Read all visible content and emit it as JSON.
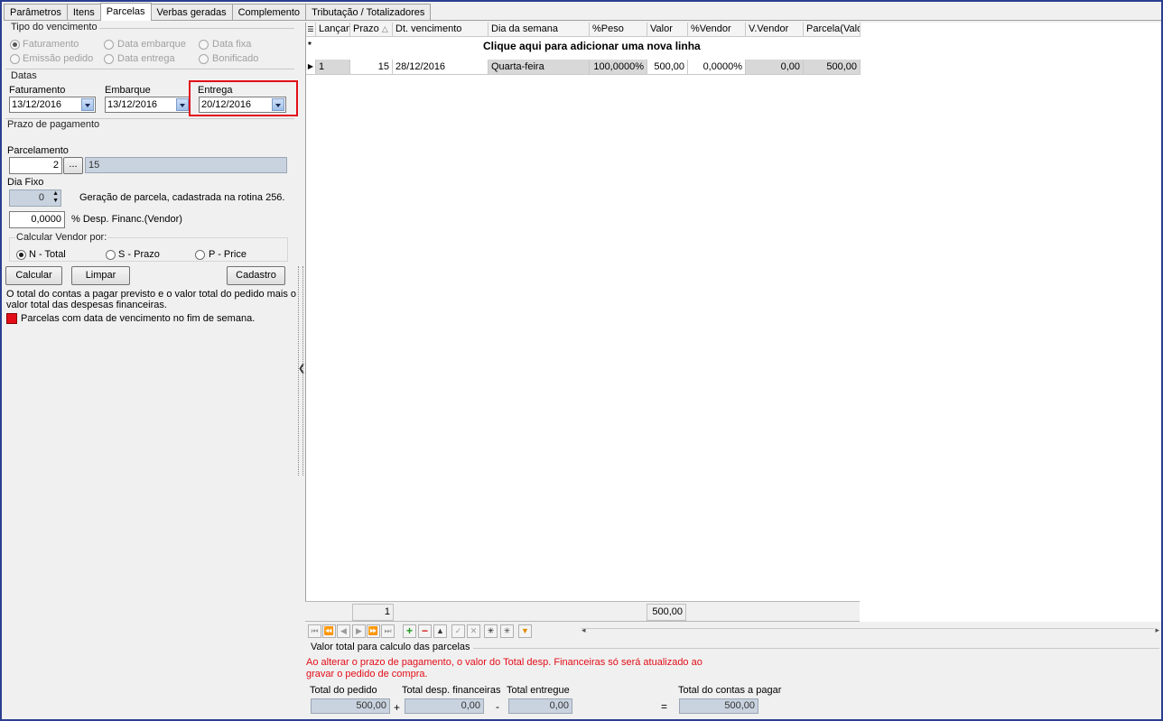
{
  "tabs": [
    {
      "label": "Parâmetros"
    },
    {
      "label": "Itens"
    },
    {
      "label": "Parcelas"
    },
    {
      "label": "Verbas geradas"
    },
    {
      "label": "Complemento"
    },
    {
      "label": "Tributação / Totalizadores"
    }
  ],
  "active_tab": "Parcelas",
  "tipo_vencimento": {
    "title": "Tipo do vencimento",
    "options": [
      {
        "label": "Faturamento",
        "checked": true
      },
      {
        "label": "Data embarque",
        "checked": false
      },
      {
        "label": "Data fixa",
        "checked": false
      },
      {
        "label": "Emissão pedido",
        "checked": false
      },
      {
        "label": "Data entrega",
        "checked": false
      },
      {
        "label": "Bonificado",
        "checked": false
      }
    ]
  },
  "datas": {
    "title": "Datas",
    "faturamento": {
      "label": "Faturamento",
      "value": "13/12/2016"
    },
    "embarque": {
      "label": "Embarque",
      "value": "13/12/2016"
    },
    "entrega": {
      "label": "Entrega",
      "value": "20/12/2016"
    }
  },
  "prazo": {
    "title": "Prazo de pagamento",
    "parcelamento_label": "Parcelamento",
    "parcelamento_value": "2",
    "ellipsis_label": "...",
    "parcelas_text": "15",
    "dia_fixo_label": "Dia Fixo",
    "dia_fixo_value": "0",
    "geracao_text": "Geração de parcela, cadastrada na rotina 256.",
    "desp_value": "0,0000",
    "desp_label": "% Desp. Financ.(Vendor)"
  },
  "calcular_vendor": {
    "title": "Calcular Vendor por:",
    "options": [
      {
        "label": "N - Total",
        "checked": true
      },
      {
        "label": "S - Prazo",
        "checked": false
      },
      {
        "label": "P - Price",
        "checked": false
      }
    ]
  },
  "buttons": {
    "calcular": "Calcular",
    "limpar": "Limpar",
    "cadastro": "Cadastro"
  },
  "info_text": "O total do contas a pagar previsto e o valor total do pedido mais o valor total das despesas financeiras.",
  "legend_text": "Parcelas com data de vencimento no fim de semana.",
  "legend_color": "#e30d18",
  "grid": {
    "columns": [
      "Lançam",
      "Prazo",
      "Dt. vencimento",
      "Dia da semana",
      "%Peso",
      "Valor",
      "%Vendor",
      "V.Vendor",
      "Parcela(Valo"
    ],
    "new_row_text": "Clique aqui para adicionar uma nova linha",
    "rows": [
      {
        "lancamento": "1",
        "prazo": "15",
        "dt_vencimento": "28/12/2016",
        "dia_semana": "Quarta-feira",
        "peso": "100,0000%",
        "valor": "500,00",
        "vendor_pct": "0,0000%",
        "v_vendor": "0,00",
        "parcela_valor": "500,00"
      }
    ],
    "footer_count": "1",
    "footer_total": "500,00"
  },
  "bottom": {
    "title": "Valor total para calculo das parcelas",
    "warning_line1": "Ao alterar o prazo de pagamento, o valor do Total desp. Financeiras só será atualizado ao",
    "warning_line2": "gravar o pedido de compra.",
    "total_pedido_label": "Total do pedido",
    "total_pedido_value": "500,00",
    "total_desp_label": "Total desp. financeiras",
    "total_desp_value": "0,00",
    "total_entregue_label": "Total entregue",
    "total_entregue_value": "0,00",
    "total_contas_label": "Total do contas a pagar",
    "total_contas_value": "500,00",
    "op_plus": "+",
    "op_minus": "-",
    "op_equals": "="
  }
}
